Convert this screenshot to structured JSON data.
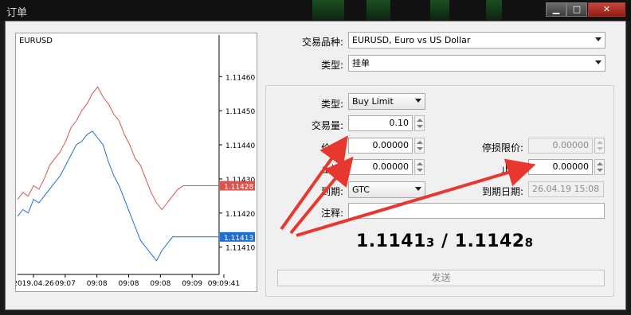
{
  "window": {
    "title": "订单",
    "min_glyph": "▁",
    "max_glyph": "□",
    "close_glyph": "✕"
  },
  "chart": {
    "symbol": "EURUSD",
    "price_ticks": [
      "1.11460",
      "1.11450",
      "1.11440",
      "1.11430",
      "1.11420",
      "1.11410"
    ],
    "time_ticks": [
      "2019.04.26",
      "09:07",
      "09:08",
      "09:08",
      "09:08",
      "09:09",
      "09:09:41"
    ],
    "ask_label": "1.11428",
    "bid_label": "1.11413",
    "ask_color": "#d9534f",
    "bid_color": "#1f6fd1"
  },
  "chart_data": {
    "type": "line",
    "ylim": [
      1.11402,
      1.11468
    ],
    "series": [
      {
        "name": "ask",
        "values": [
          1.11424,
          1.11426,
          1.11425,
          1.11428,
          1.11427,
          1.1143,
          1.11434,
          1.11436,
          1.11438,
          1.11441,
          1.11445,
          1.11447,
          1.1145,
          1.11452,
          1.11455,
          1.11457,
          1.11454,
          1.11452,
          1.11449,
          1.11447,
          1.11443,
          1.1144,
          1.11436,
          1.11434,
          1.1143,
          1.11426,
          1.11423,
          1.11421,
          1.11423,
          1.11425,
          1.11427,
          1.11428
        ]
      },
      {
        "name": "bid",
        "values": [
          1.11419,
          1.11421,
          1.1142,
          1.11424,
          1.11423,
          1.11425,
          1.11427,
          1.11429,
          1.11431,
          1.11434,
          1.11437,
          1.1144,
          1.11441,
          1.11443,
          1.11444,
          1.11442,
          1.1144,
          1.11435,
          1.11431,
          1.11428,
          1.11424,
          1.1142,
          1.11416,
          1.11412,
          1.1141,
          1.11408,
          1.11406,
          1.11409,
          1.11411,
          1.11413,
          1.11413,
          1.11413
        ]
      }
    ]
  },
  "form": {
    "symbol_label": "交易品种:",
    "symbol_value": "EURUSD, Euro vs US Dollar",
    "type_label": "类型:",
    "type_value": "挂单",
    "order_type_label": "类型:",
    "order_type_value": "Buy Limit",
    "volume_label": "交易量:",
    "volume_value": "0.10",
    "price_label": "价位:",
    "price_value": "0.00000",
    "stop_limit_label": "停损限价:",
    "stop_limit_value": "0.00000",
    "sl_label": "止损:",
    "sl_value": "0.00000",
    "tp_label": "止盈:",
    "tp_value": "0.00000",
    "expiry_label": "到期:",
    "expiry_value": "GTC",
    "expiry_date_label": "到期日期:",
    "expiry_date_value": "26.04.19 15:08",
    "comment_label": "注释:",
    "comment_value": "",
    "quote_bid": "1.1141",
    "quote_bid_small": "3",
    "quote_sep": " / ",
    "quote_ask": "1.1142",
    "quote_ask_small": "8",
    "send_label": "发送"
  },
  "annotation": {
    "arrow_color": "#e8372e"
  }
}
